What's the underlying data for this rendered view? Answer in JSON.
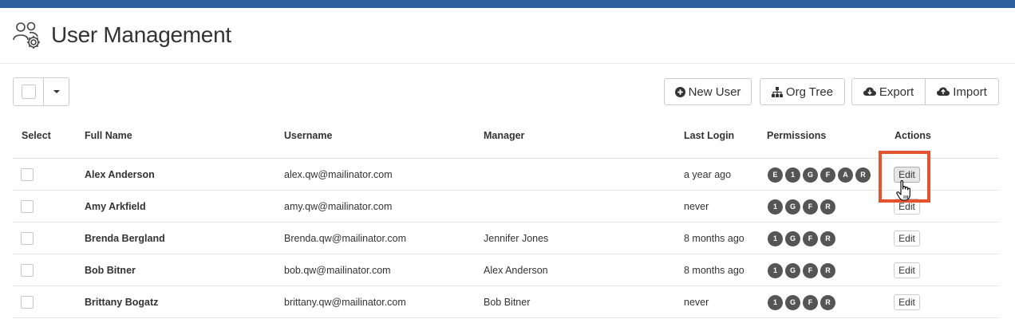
{
  "header": {
    "title": "User Management",
    "icon": "users-gear-icon"
  },
  "toolbar": {
    "new_user": "New User",
    "org_tree": "Org Tree",
    "export": "Export",
    "import": "Import"
  },
  "table": {
    "columns": [
      "Select",
      "Full Name",
      "Username",
      "Manager",
      "Last Login",
      "Permissions",
      "Actions"
    ],
    "edit_label": "Edit",
    "rows": [
      {
        "name": "Alex Anderson",
        "username": "alex.qw@mailinator.com",
        "manager": "",
        "last_login": "a year ago",
        "permissions": [
          "E",
          "1",
          "G",
          "F",
          "A",
          "R"
        ]
      },
      {
        "name": "Amy Arkfield",
        "username": "amy.qw@mailinator.com",
        "manager": "",
        "last_login": "never",
        "permissions": [
          "1",
          "G",
          "F",
          "R"
        ]
      },
      {
        "name": "Brenda Bergland",
        "username": "Brenda.qw@mailinator.com",
        "manager": "Jennifer Jones",
        "last_login": "8 months ago",
        "permissions": [
          "1",
          "G",
          "F",
          "R"
        ]
      },
      {
        "name": "Bob Bitner",
        "username": "bob.qw@mailinator.com",
        "manager": "Alex Anderson",
        "last_login": "8 months ago",
        "permissions": [
          "1",
          "G",
          "F",
          "R"
        ]
      },
      {
        "name": "Brittany Bogatz",
        "username": "brittany.qw@mailinator.com",
        "manager": "Bob Bitner",
        "last_login": "never",
        "permissions": [
          "1",
          "G",
          "F",
          "R"
        ]
      }
    ]
  },
  "colors": {
    "top_bar": "#2f5f9e",
    "highlight": "#e5532e",
    "permission_badge": "#555555"
  }
}
